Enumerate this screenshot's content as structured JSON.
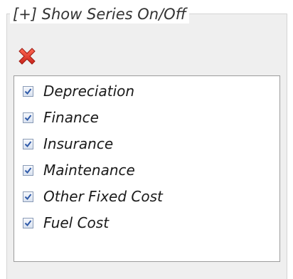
{
  "panel": {
    "legend": "[+] Show Series On/Off",
    "clear_icon": "red-x-icon",
    "series": [
      {
        "label": "Depreciation",
        "checked": true
      },
      {
        "label": "Finance",
        "checked": true
      },
      {
        "label": "Insurance",
        "checked": true
      },
      {
        "label": "Maintenance",
        "checked": true
      },
      {
        "label": "Other Fixed Cost",
        "checked": true
      },
      {
        "label": "Fuel Cost",
        "checked": true
      }
    ]
  },
  "colors": {
    "x_red": "#e53a2a",
    "check_blue": "#2f5aa8",
    "panel_bg": "#efefef"
  }
}
